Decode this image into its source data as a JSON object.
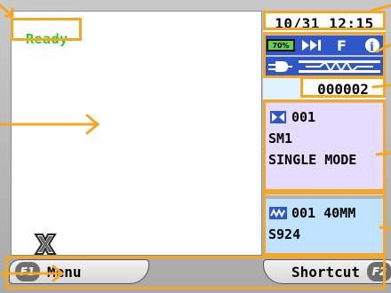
{
  "status": {
    "text": "Ready",
    "color": "#1fd11f"
  },
  "datetime": "10/31 12:15",
  "indicators": {
    "battery": "70%",
    "icons": [
      "fast-forward-icon",
      "f-icon",
      "info-icon",
      "plug-icon",
      "arc-icon"
    ]
  },
  "counter": "000002",
  "fiber": {
    "code": "001",
    "type": "SM1",
    "mode": "SINGLE MODE"
  },
  "splice": {
    "line1": "001 40MM",
    "line2": "S924"
  },
  "softkeys": {
    "left": {
      "key": "F1",
      "label": "Menu"
    },
    "right": {
      "key": "F2",
      "label": "Shortcut"
    }
  },
  "colors": {
    "highlight": "#f5a623",
    "icon_bar": "#2f57c8",
    "fiber_panel": "#e6dcff",
    "splice_panel": "#bfe3ff"
  }
}
